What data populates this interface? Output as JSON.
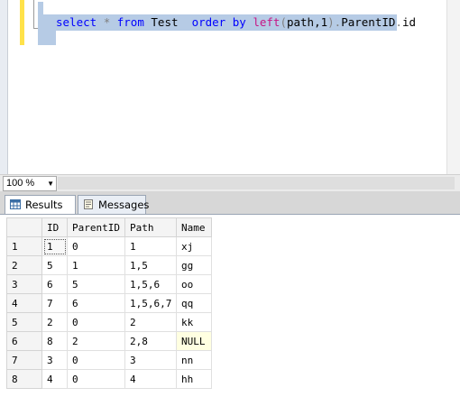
{
  "editor": {
    "sql_select": "select",
    "sql_star": "*",
    "sql_from": "from",
    "sql_table": "Test",
    "sql_order": "order",
    "sql_by": "by",
    "sql_left": "left",
    "sql_open": "(",
    "sql_arg": "path,1",
    "sql_close": ")",
    "sql_dot1": ".",
    "sql_parentid": "ParentID",
    "sql_dot2": ".",
    "sql_id": "id"
  },
  "zoom": {
    "value": "100 %"
  },
  "tabs": {
    "results_label": "Results",
    "messages_label": "Messages"
  },
  "grid": {
    "columns": [
      "ID",
      "ParentID",
      "Path",
      "Name"
    ],
    "rows": [
      {
        "num": "1",
        "cells": [
          "1",
          "0",
          "1",
          "xj"
        ]
      },
      {
        "num": "2",
        "cells": [
          "5",
          "1",
          "1,5",
          "gg"
        ]
      },
      {
        "num": "3",
        "cells": [
          "6",
          "5",
          "1,5,6",
          "oo"
        ]
      },
      {
        "num": "4",
        "cells": [
          "7",
          "6",
          "1,5,6,7",
          "qq"
        ]
      },
      {
        "num": "5",
        "cells": [
          "2",
          "0",
          "2",
          "kk"
        ]
      },
      {
        "num": "6",
        "cells": [
          "8",
          "2",
          "2,8",
          "NULL"
        ]
      },
      {
        "num": "7",
        "cells": [
          "3",
          "0",
          "3",
          "nn"
        ]
      },
      {
        "num": "8",
        "cells": [
          "4",
          "0",
          "4",
          "hh"
        ]
      }
    ]
  },
  "colors": {
    "selection": "#b6cbe5",
    "keyword": "#0000ff",
    "function": "#c71585",
    "null_cell": "#ffffe1"
  }
}
